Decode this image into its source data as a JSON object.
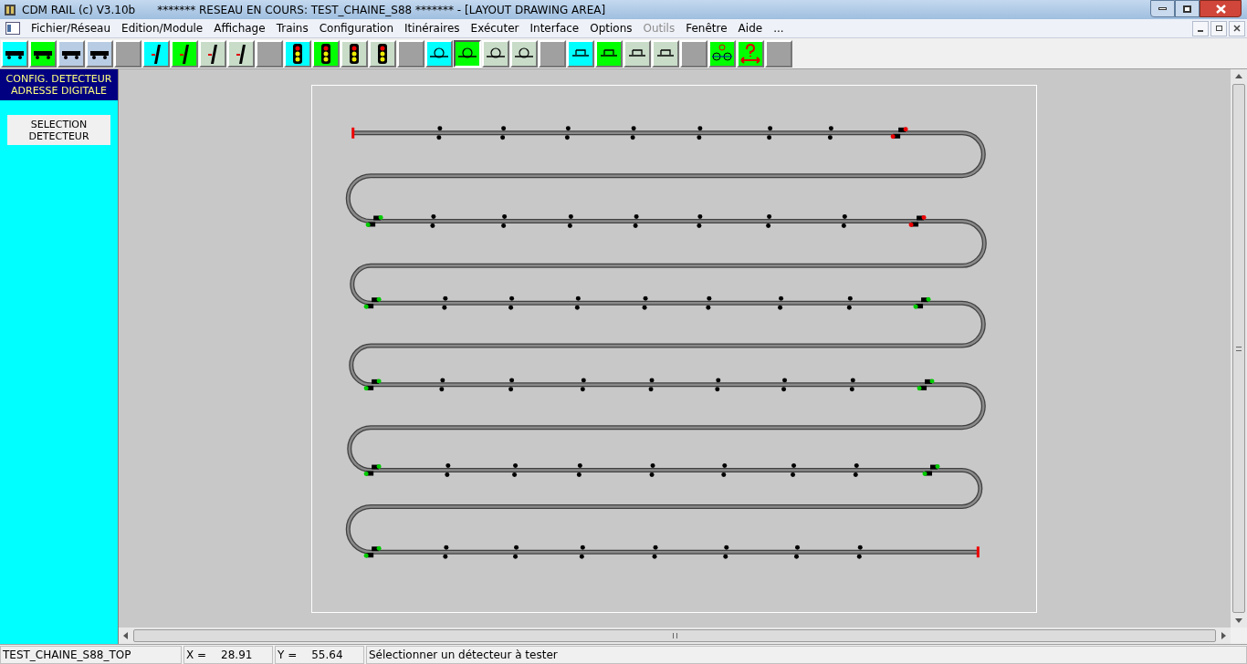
{
  "window": {
    "title": "CDM RAIL (c) V3.10b",
    "document_title": "******* RESEAU EN COURS: TEST_CHAINE_S88 ******* - [LAYOUT DRAWING AREA]"
  },
  "menu": [
    {
      "label": "Fichier/Réseau",
      "disabled": false
    },
    {
      "label": "Edition/Module",
      "disabled": false
    },
    {
      "label": "Affichage",
      "disabled": false
    },
    {
      "label": "Trains",
      "disabled": false
    },
    {
      "label": "Configuration",
      "disabled": false
    },
    {
      "label": "Itinéraires",
      "disabled": false
    },
    {
      "label": "Exécuter",
      "disabled": false
    },
    {
      "label": "Interface",
      "disabled": false
    },
    {
      "label": "Options",
      "disabled": false
    },
    {
      "label": "Outils",
      "disabled": true
    },
    {
      "label": "Fenêtre",
      "disabled": false
    },
    {
      "label": "Aide",
      "disabled": false
    },
    {
      "label": "...",
      "disabled": false
    }
  ],
  "toolbar": [
    {
      "kind": "loco",
      "color": "#00ffff",
      "selected": false
    },
    {
      "kind": "loco",
      "color": "#00ff00",
      "selected": false
    },
    {
      "kind": "loco",
      "color": "#b8cce4",
      "selected": false
    },
    {
      "kind": "loco",
      "color": "#b8cce4",
      "selected": false
    },
    {
      "kind": "blank",
      "color": "#a0a0a0",
      "selected": false
    },
    {
      "kind": "turnout",
      "color": "#00ffff",
      "selected": false
    },
    {
      "kind": "turnout",
      "color": "#00ff00",
      "selected": false
    },
    {
      "kind": "turnout",
      "color": "#c8dcc8",
      "selected": false
    },
    {
      "kind": "turnout",
      "color": "#c8dcc8",
      "selected": false
    },
    {
      "kind": "blank",
      "color": "#a0a0a0",
      "selected": false
    },
    {
      "kind": "signal",
      "color": "#00ffff",
      "selected": false
    },
    {
      "kind": "signal",
      "color": "#00ff00",
      "selected": false
    },
    {
      "kind": "signal",
      "color": "#c8dcc8",
      "selected": false
    },
    {
      "kind": "signal",
      "color": "#c8dcc8",
      "selected": false
    },
    {
      "kind": "blank",
      "color": "#a0a0a0",
      "selected": false
    },
    {
      "kind": "detector",
      "color": "#00ffff",
      "selected": false
    },
    {
      "kind": "detector",
      "color": "#00ff00",
      "selected": true
    },
    {
      "kind": "detector",
      "color": "#c8dcc8",
      "selected": false
    },
    {
      "kind": "detector",
      "color": "#c8dcc8",
      "selected": false
    },
    {
      "kind": "blank",
      "color": "#a0a0a0",
      "selected": false
    },
    {
      "kind": "platform",
      "color": "#00ffff",
      "selected": false
    },
    {
      "kind": "platform",
      "color": "#00ff00",
      "selected": false
    },
    {
      "kind": "platform",
      "color": "#c8dcc8",
      "selected": false
    },
    {
      "kind": "platform",
      "color": "#c8dcc8",
      "selected": false
    },
    {
      "kind": "blank",
      "color": "#a0a0a0",
      "selected": false
    },
    {
      "kind": "wheels",
      "color": "#00ff00",
      "selected": false
    },
    {
      "kind": "question",
      "color": "#00ff00",
      "selected": false
    },
    {
      "kind": "blank",
      "color": "#a0a0a0",
      "selected": false
    }
  ],
  "side_panel": {
    "header": [
      "CONFIG. DETECTEUR",
      "ADRESSE DIGITALE"
    ],
    "button": "SELECTION DETECTEUR"
  },
  "status_bar": {
    "layout": "TEST_CHAINE_S88_TOP",
    "x_label": "X =",
    "x_value": "28.91",
    "y_label": "Y =",
    "y_value": "55.64",
    "message": "Sélectionner un détecteur à tester"
  }
}
